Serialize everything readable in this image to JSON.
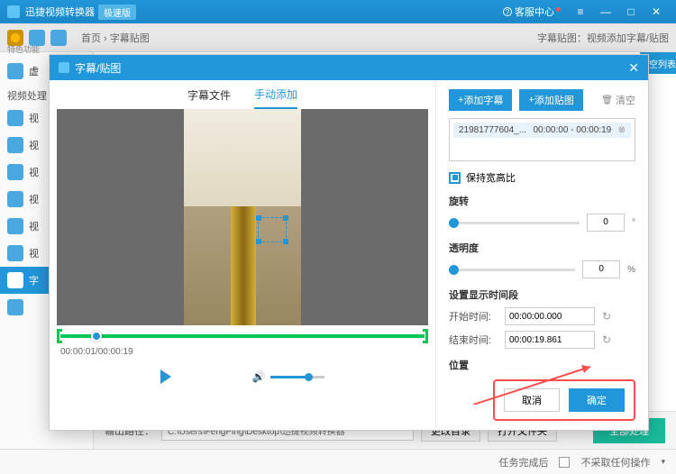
{
  "titlebar": {
    "appName": "迅捷视频转换器",
    "badge": "极速版",
    "helpCenter": "客服中心"
  },
  "toolbar": {
    "tag1": "特色功能",
    "breadcrumb": "首页 › 字幕贴图",
    "rightText": "字幕贴图：视频添加字幕/贴图"
  },
  "sidebar": {
    "section1": "视频处理",
    "items": [
      "虚",
      "视",
      "视",
      "视",
      "视",
      "视",
      "视",
      "字",
      ""
    ]
  },
  "sideStrip": "清空列表",
  "dialog": {
    "title": "字幕/贴图",
    "tabs": {
      "subtitle": "字幕文件",
      "manual": "手动添加"
    },
    "timeText": "00:00:01/00:00:19",
    "addSubtitle": "添加字幕",
    "addSticker": "添加贴图",
    "clear": "清空",
    "listItem": {
      "name": "21981777604_...",
      "range": "00:00:00 - 00:00:19"
    },
    "keepRatio": "保持宽高比",
    "rotateLabel": "旋转",
    "rotateVal": "0",
    "rotateUnit": "°",
    "opacityLabel": "透明度",
    "opacityVal": "0",
    "opacityUnit": "%",
    "timeRangeLabel": "设置显示时间段",
    "startLabel": "开始时间:",
    "startVal": "00:00:00.000",
    "endLabel": "结束时间:",
    "endVal": "00:00:19.861",
    "posLabel": "位置",
    "cancel": "取消",
    "ok": "确定"
  },
  "bottombar": {
    "pathLabel": "输出路径：",
    "pathValue": "C:\\Users\\FengPing\\Desktop\\迅捷视频转换器",
    "changeDir": "更改目录",
    "openFolder": "打开文件夹",
    "process": "全部处理"
  },
  "statusbar": {
    "afterDone": "任务完成后",
    "noAction": "不采取任何操作"
  }
}
